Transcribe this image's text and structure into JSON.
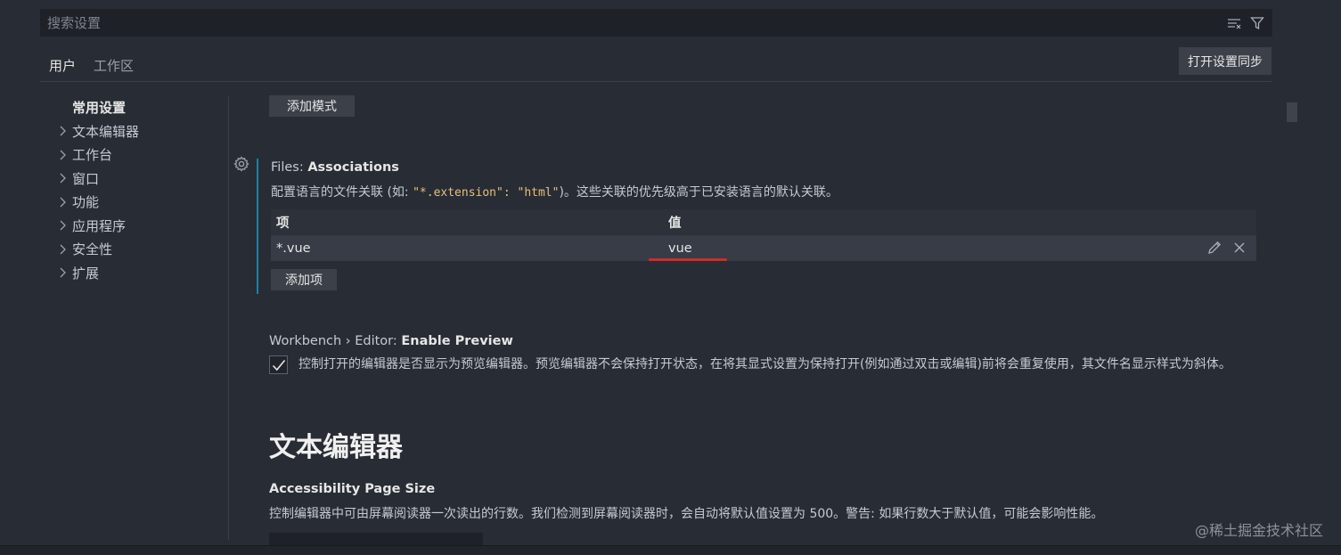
{
  "search": {
    "placeholder": "搜索设置"
  },
  "tabs": [
    {
      "label": "用户",
      "active": true
    },
    {
      "label": "工作区",
      "active": false
    }
  ],
  "sync_button": "打开设置同步",
  "toc": {
    "header": "常用设置",
    "items": [
      "文本编辑器",
      "工作台",
      "窗口",
      "功能",
      "应用程序",
      "安全性",
      "扩展"
    ]
  },
  "settings": {
    "add_pattern_label": "添加模式",
    "files_associations": {
      "category": "Files:",
      "name": "Associations",
      "desc_prefix": "配置语言的文件关联 (如: ",
      "desc_code": "\"*.extension\": \"html\"",
      "desc_suffix": ")。这些关联的优先级高于已安装语言的默认关联。",
      "table_header_key": "项",
      "table_header_value": "值",
      "rows": [
        {
          "key": "*.vue",
          "value": "vue"
        }
      ],
      "add_item_label": "添加项"
    },
    "enable_preview": {
      "category": "Workbench › Editor:",
      "name": "Enable Preview",
      "checked": true,
      "desc": "控制打开的编辑器是否显示为预览编辑器。预览编辑器不会保持打开状态，在将其显式设置为保持打开(例如通过双击或编辑)前将会重复使用，其文件名显示样式为斜体。"
    },
    "section_heading": "文本编辑器",
    "accessibility_page_size": {
      "name": "Accessibility Page Size",
      "desc": "控制编辑器中可由屏幕阅读器一次读出的行数。我们检测到屏幕阅读器时，会自动将默认值设置为 500。警告: 如果行数大于默认值，可能会影响性能。"
    }
  },
  "watermark": "@稀土掘金技术社区",
  "colors": {
    "background": "#282c34",
    "accent_border": "#1f7ea6",
    "highlight_underline": "#d32a2a"
  }
}
